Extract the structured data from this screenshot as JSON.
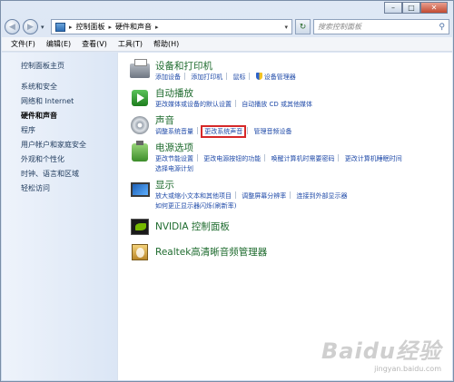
{
  "window_buttons": {
    "minimize": "–",
    "maximize": "□",
    "close": "✕"
  },
  "address": {
    "crumbs": [
      "控制面板",
      "硬件和声音"
    ],
    "search_placeholder": "搜索控制面板"
  },
  "menu": [
    "文件(F)",
    "编辑(E)",
    "查看(V)",
    "工具(T)",
    "帮助(H)"
  ],
  "sidebar": {
    "items": [
      {
        "label": "控制面板主页"
      },
      {
        "label": "系统和安全"
      },
      {
        "label": "网络和 Internet"
      },
      {
        "label": "硬件和声音",
        "current": true
      },
      {
        "label": "程序"
      },
      {
        "label": "用户帐户和家庭安全"
      },
      {
        "label": "外观和个性化"
      },
      {
        "label": "时钟、语言和区域"
      },
      {
        "label": "轻松访问"
      }
    ]
  },
  "categories": {
    "devices": {
      "title": "设备和打印机",
      "links": [
        "添加设备",
        "添加打印机",
        "鼠标",
        "设备管理器"
      ]
    },
    "autoplay": {
      "title": "自动播放",
      "links": [
        "更改媒体或设备的默认设置",
        "自动播放 CD 或其他媒体"
      ]
    },
    "sound": {
      "title": "声音",
      "links": [
        "调整系统音量",
        "更改系统声音",
        "管理音频设备"
      ]
    },
    "power": {
      "title": "电源选项",
      "links": [
        "更改节能设置",
        "更改电源按钮的功能",
        "唤醒计算机时需要密码",
        "更改计算机睡眠时间",
        "选择电源计划"
      ]
    },
    "display": {
      "title": "显示",
      "links": [
        "放大或缩小文本和其他项目",
        "调整屏幕分辨率",
        "连接到外部显示器",
        "如何更正显示器闪烁(刷新率)"
      ]
    },
    "nvidia": {
      "title": "NVIDIA 控制面板"
    },
    "realtek": {
      "title": "Realtek高清晰音频管理器"
    }
  },
  "watermark": {
    "main": "Baidu经验",
    "sub": "jingyan.baidu.com"
  },
  "colors": {
    "highlight_box": "#d62828",
    "category_title": "#1e6b2e",
    "link": "#1f4aa8"
  }
}
